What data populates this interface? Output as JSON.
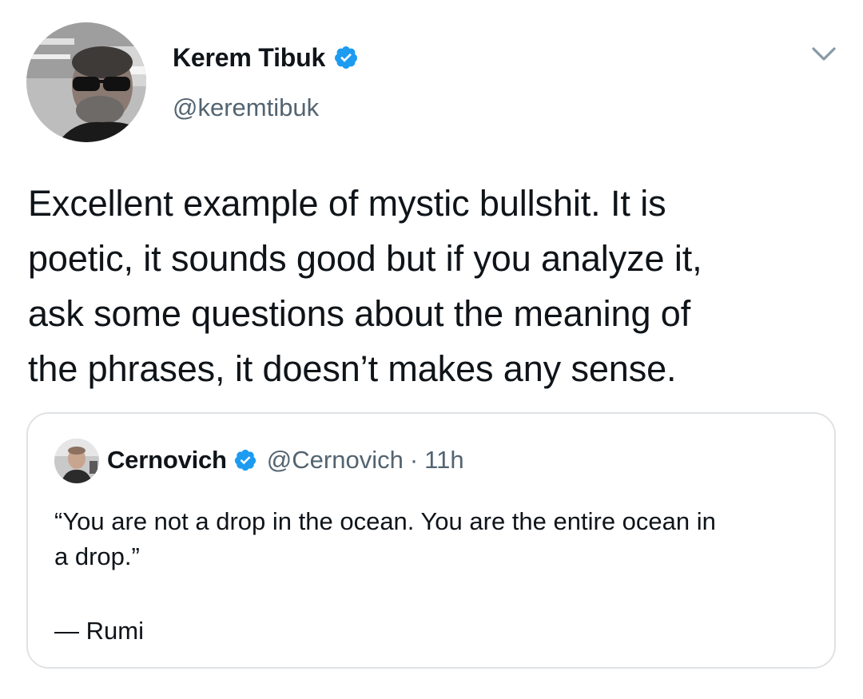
{
  "author": {
    "display_name": "Kerem Tibuk",
    "handle": "@keremtibuk",
    "verified": true,
    "avatar_icon": "profile-photo-man-sunglasses"
  },
  "menu": {
    "icon": "chevron-down-icon"
  },
  "tweet": {
    "lines": [
      "Excellent example of mystic bullshit. It is",
      "poetic, it sounds good but if you analyze it,",
      "ask some questions about the meaning of",
      "the phrases, it doesn’t makes any sense."
    ]
  },
  "quoted_tweet": {
    "display_name": "Cernovich",
    "handle": "@Cernovich",
    "separator": "·",
    "time": "11h",
    "verified": true,
    "text_lines": [
      "“You are not a drop in the ocean. You are the entire ocean in",
      "a drop.”"
    ],
    "attribution": "— Rumi"
  },
  "colors": {
    "verified_blue": "#1d9bf0",
    "secondary_text": "#536471",
    "border": "#dfe3e6",
    "primary_text": "#0f1419"
  }
}
